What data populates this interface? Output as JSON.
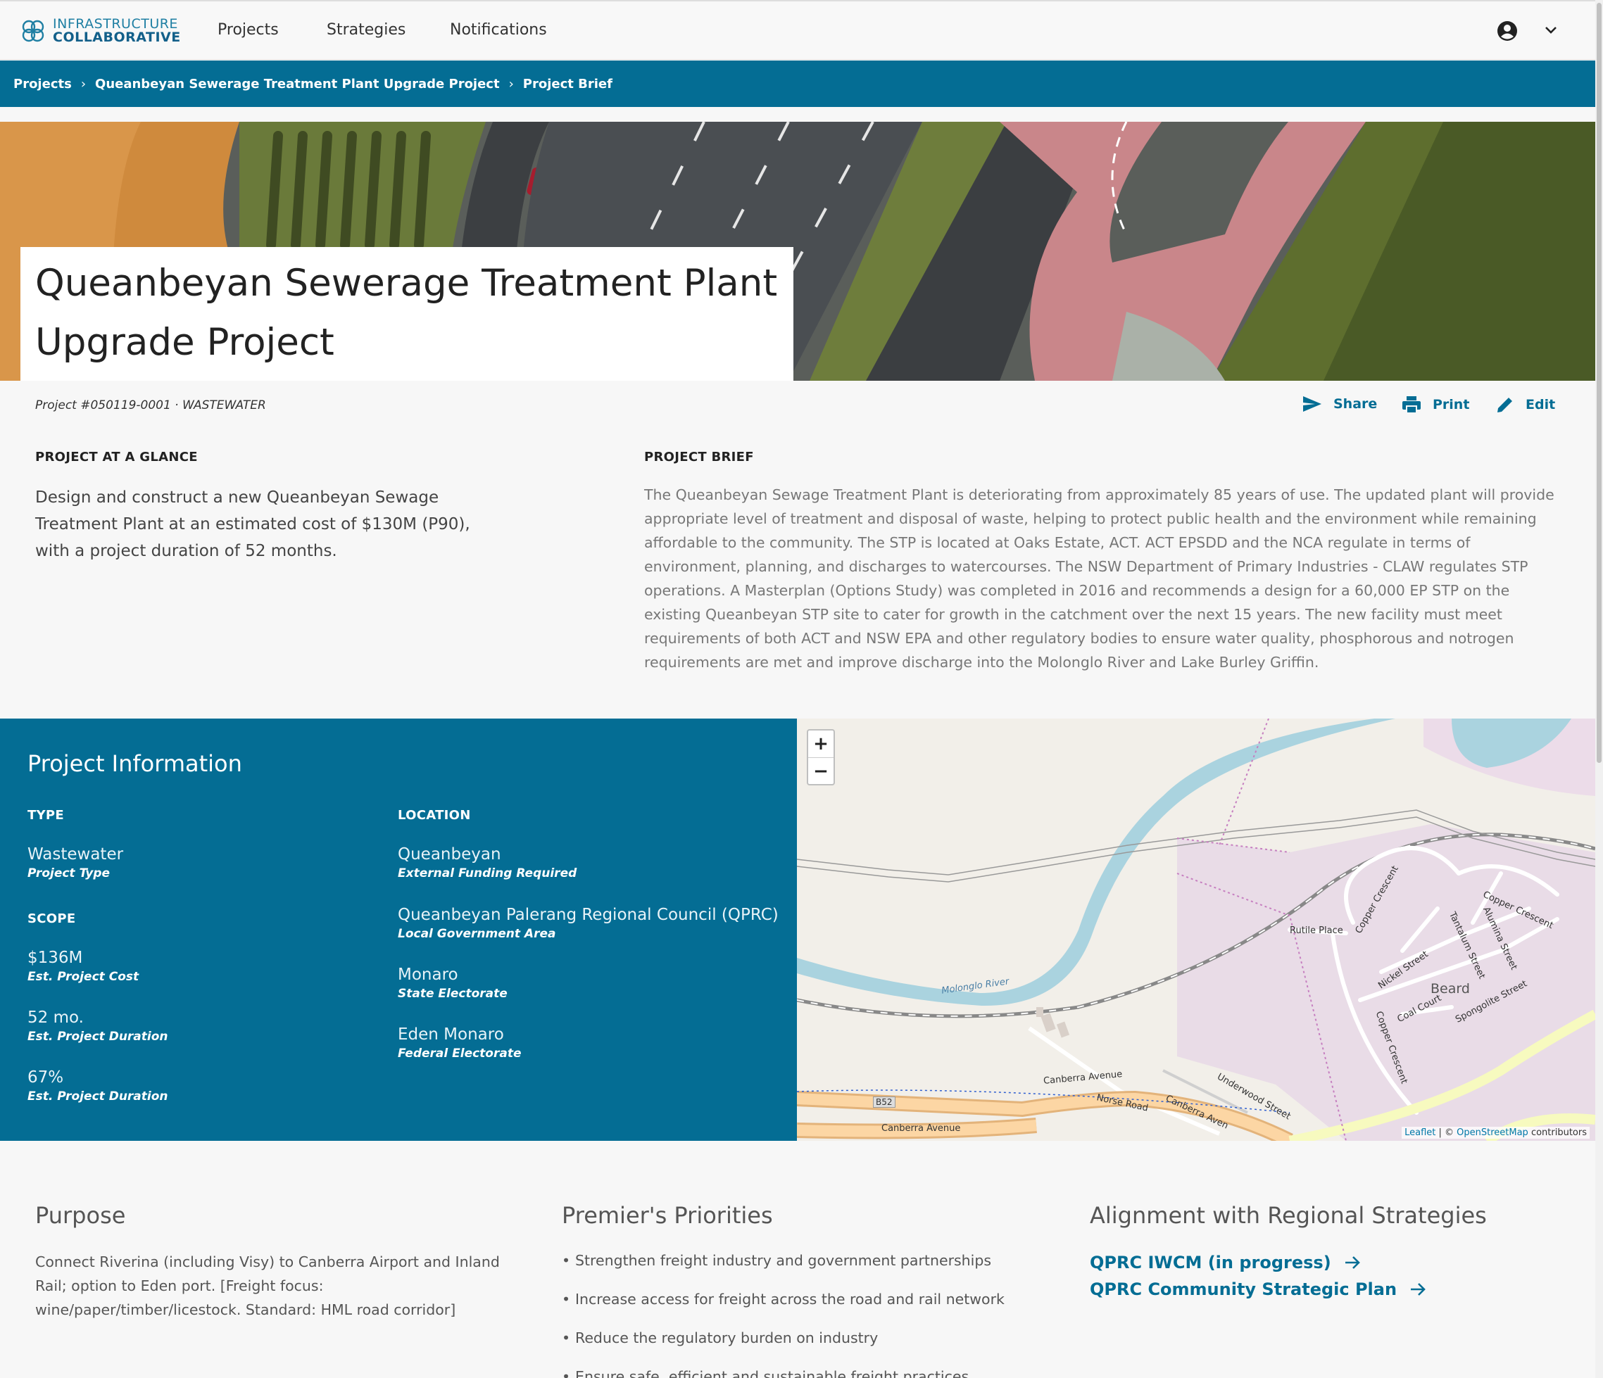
{
  "nav": {
    "logo_line1": "INFRASTRUCTURE",
    "logo_line2": "COLLABORATIVE",
    "links": [
      "Projects",
      "Strategies",
      "Notifications"
    ]
  },
  "breadcrumb": {
    "items": [
      "Projects",
      "Queanbeyan Sewerage Treatment Plant Upgrade Project",
      "Project Brief"
    ],
    "separator": "›"
  },
  "project": {
    "title_line1": "Queanbeyan Sewerage Treatment Plant",
    "title_line2": "Upgrade Project",
    "meta": "Project #050119-0001 · WASTEWATER"
  },
  "actions": {
    "share": "Share",
    "print": "Print",
    "edit": "Edit"
  },
  "glance": {
    "label": "PROJECT AT A GLANCE",
    "text": "Design and construct a new Queanbeyan Sewage Treatment Plant at an estimated cost of $130M (P90), with a project duration of 52 months."
  },
  "brief": {
    "label": "PROJECT BRIEF",
    "text": "The Queanbeyan Sewage Treatment Plant is deteriorating from approximately 85 years of use. The updated plant will provide appropriate level of treatment and disposal of waste, helping to protect public health and the environment while remaining affordable to the community. The STP is located at Oaks Estate, ACT. ACT EPSDD and the NCA regulate in terms of environment, planning, and discharges to watercourses. The NSW Department of Primary Industries - CLAW regulates STP operations. A Masterplan (Options Study) was completed in 2016 and recommends a design for a 60,000 EP STP on the existing Queanbeyan STP site to cater for growth in the catchment over the next 15 years. The new facility must meet requirements of both ACT and NSW EPA and other regulatory bodies to ensure water quality, phosphorous and notrogen requirements are met and improve discharge into the Molonglo River and Lake Burley Griffin."
  },
  "info": {
    "heading": "Project Information",
    "type_label": "TYPE",
    "type": {
      "value": "Wastewater",
      "sub": "Project Type"
    },
    "scope_label": "SCOPE",
    "scope": [
      {
        "value": "$136M",
        "sub": "Est. Project Cost"
      },
      {
        "value": "52 mo.",
        "sub": "Est. Project Duration"
      },
      {
        "value": "67%",
        "sub": "Est. Project Duration"
      }
    ],
    "location_label": "LOCATION",
    "location": [
      {
        "value": "Queanbeyan",
        "sub": "External Funding Required"
      },
      {
        "value": "Queanbeyan Palerang Regional Council (QPRC)",
        "sub": "Local Government Area"
      },
      {
        "value": "Monaro",
        "sub": "State Electorate"
      },
      {
        "value": "Eden Monaro",
        "sub": "Federal Electorate"
      }
    ]
  },
  "map": {
    "zoom_in": "+",
    "zoom_out": "−",
    "attribution_leaflet": "Leaflet",
    "attribution_mid": " | © ",
    "attribution_osm": "OpenStreetMap",
    "attribution_end": " contributors",
    "labels": {
      "river": "Molonglo River",
      "suburb": "Beard",
      "rutile": "Rutile Place",
      "copper1": "Copper Crescent",
      "copper2": "Copper Crescent",
      "copper3": "Copper Crescent",
      "tantalum": "Tantalum Street",
      "alumina": "Alumina Street",
      "nickel": "Nickel Street",
      "coal": "Coal Court",
      "spongolite": "Spongolite Street",
      "underwood": "Underwood Street",
      "canberra1": "Canberra Avenue",
      "canberra2": "Canberra Avenue",
      "canberra3": "Canberra Aven",
      "norse": "Norse Road",
      "b52": "B52"
    },
    "colors": {
      "land": "#f2efe9",
      "water": "#aad3df",
      "residential": "#e8d8e6",
      "road_primary": "#fcd6a4"
    }
  },
  "purpose": {
    "heading": "Purpose",
    "text": "Connect Riverina (including Visy) to Canberra Airport and Inland Rail; option to Eden port. [Freight focus: wine/paper/timber/licestock. Standard: HML road corridor]"
  },
  "priorities": {
    "heading": "Premier's Priorities",
    "items": [
      "Strengthen freight industry and government partnerships",
      "Increase access for freight across the road and rail network",
      "Reduce the regulatory burden on industry",
      "Ensure safe, efficient and sustainable freight practices"
    ]
  },
  "alignment": {
    "heading": "Alignment with Regional Strategies",
    "links": [
      "QPRC IWCM (in progress)",
      "QPRC Community Strategic Plan"
    ]
  },
  "colors": {
    "brand": "#046d94",
    "background": "#f7f7f7"
  }
}
